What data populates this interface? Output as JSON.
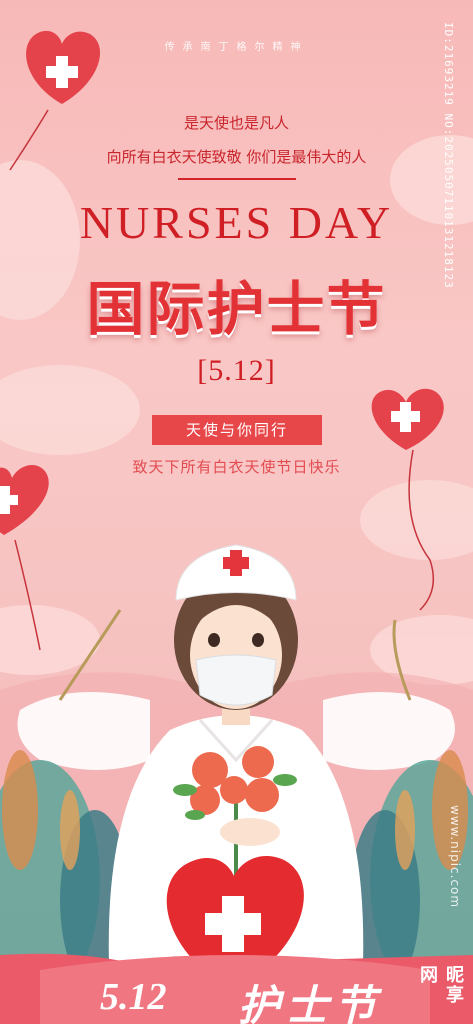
{
  "header": {
    "tagline": "传承南丁格尔精神",
    "line1": "是天使也是凡人",
    "line2": "向所有白衣天使致敬 你们是最伟大的人"
  },
  "title": {
    "english": "NURSES DAY",
    "chinese": "国际护士节",
    "date": "[5.12]"
  },
  "badge": {
    "label": "天使与你同行"
  },
  "subtitle": "致天下所有白衣天使节日快乐",
  "footer": {
    "date": "5.12",
    "label": "护士节"
  },
  "watermark": {
    "id": "ID:21693219 NO:20250507110131218123",
    "site": "www.nipic.com",
    "brand": "昵享网"
  },
  "colors": {
    "accent": "#cf1f25",
    "badge": "#e8474a",
    "background": "#f7b9b8"
  },
  "icons": [
    "heart-balloon-icon",
    "red-cross-icon",
    "nurse-illustration",
    "flower-bouquet-icon",
    "heart-cross-icon"
  ]
}
